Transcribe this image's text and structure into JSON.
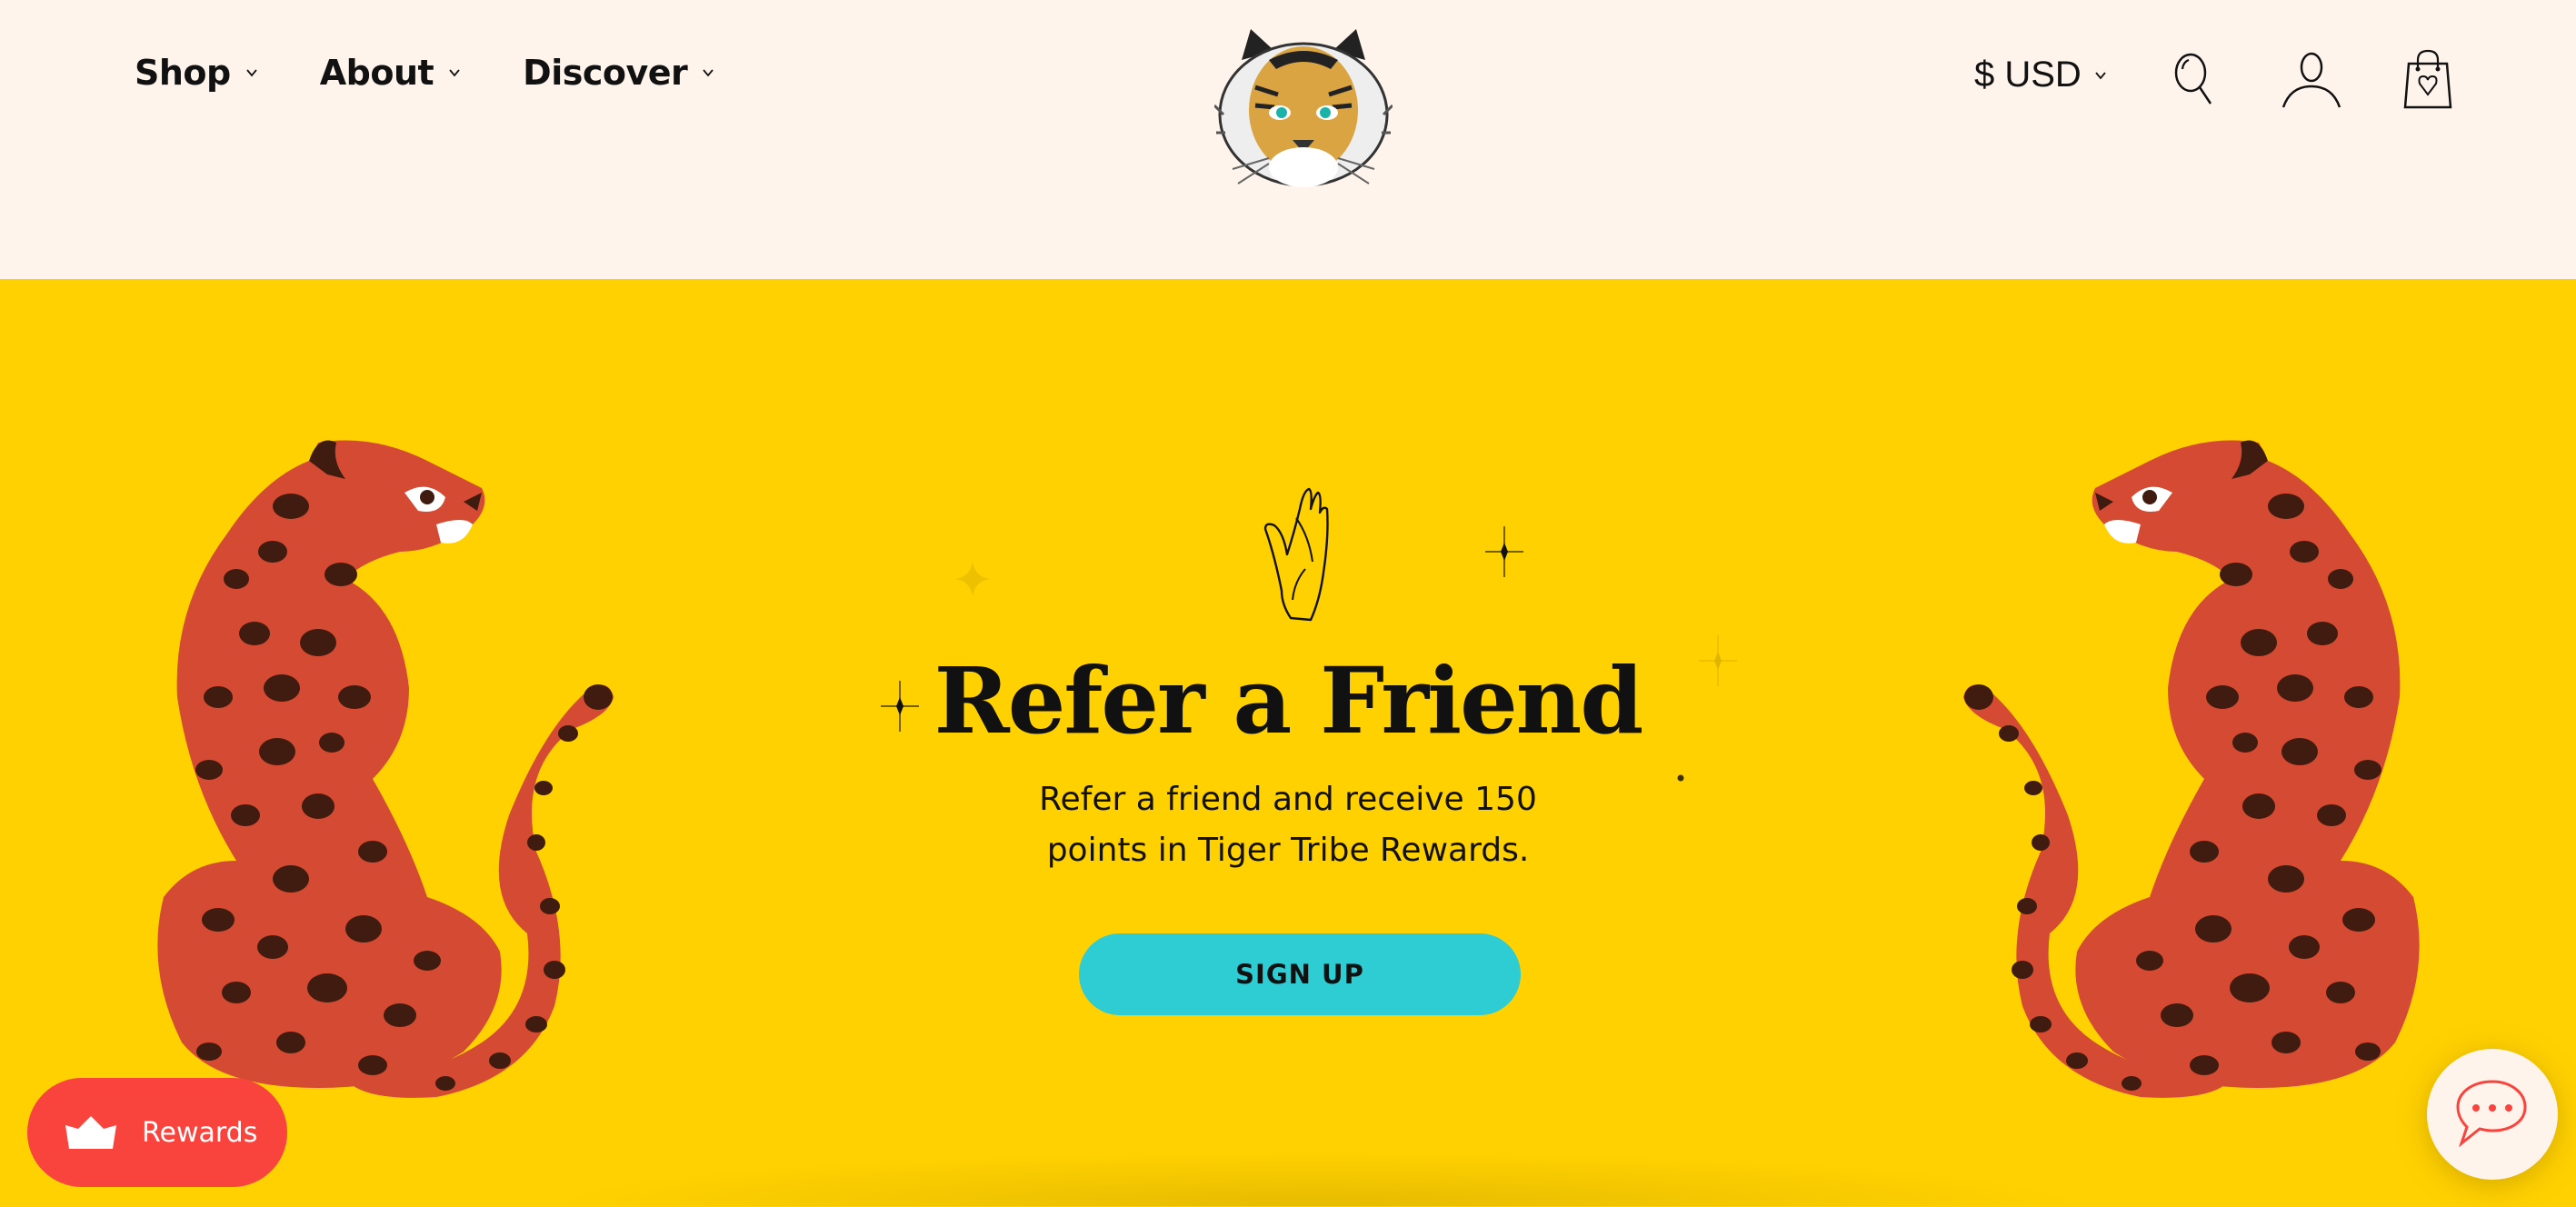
{
  "header": {
    "nav": [
      {
        "label": "Shop"
      },
      {
        "label": "About"
      },
      {
        "label": "Discover"
      }
    ],
    "logo_alt": "tiger-head-logo",
    "currency": "$ USD",
    "icons": [
      "search-icon",
      "account-icon",
      "shopping-bag-heart-icon"
    ]
  },
  "hero": {
    "title": "Refer a Friend",
    "subtitle_line1": "Refer a friend and receive 150",
    "subtitle_line2": "points in Tiger Tribe Rewards.",
    "cta_label": "SIGN UP"
  },
  "widgets": {
    "rewards_label": "Rewards",
    "chat_icon": "chat-bubble-icon"
  },
  "colors": {
    "header_bg": "#FFF4EC",
    "hero_bg": "#FFD100",
    "cta_bg": "#2ECCD3",
    "rewards_bg": "#F9443E",
    "cheetah": "#D54A32",
    "spots": "#3F1C0F"
  }
}
